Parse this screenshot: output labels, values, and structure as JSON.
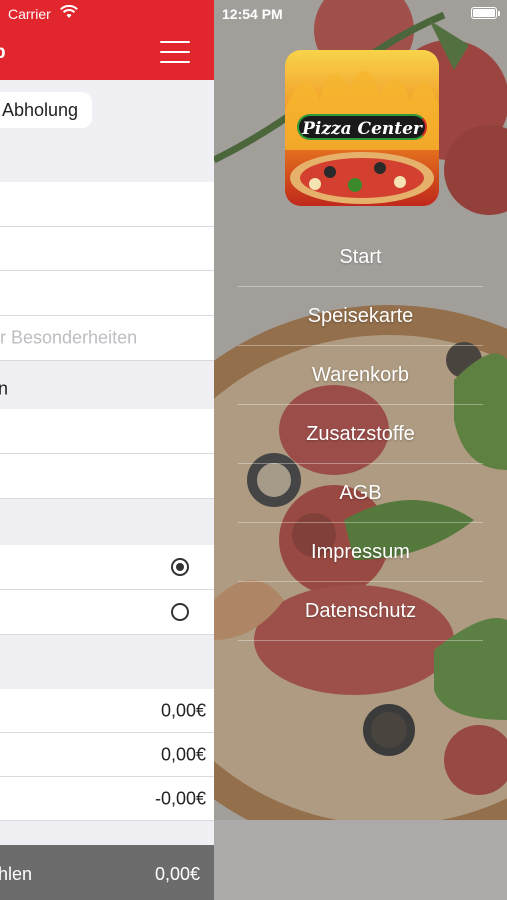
{
  "cart_panel": {
    "status": {
      "carrier": "Carrier"
    },
    "header": {
      "title": "b"
    },
    "delivery_option": "Abholung",
    "note_placeholder": "r Besonderheiten",
    "field_fragment": "n",
    "amounts": [
      "0,00€",
      "0,00€",
      "-0,00€"
    ],
    "bottom": {
      "label": "hlen",
      "total": "0,00€"
    }
  },
  "drawer": {
    "status": {
      "time": "12:54 PM"
    },
    "logo_text": "Pizza Center",
    "menu": [
      "Start",
      "Speisekarte",
      "Warenkorb",
      "Zusatzstoffe",
      "AGB",
      "Impressum",
      "Datenschutz"
    ]
  },
  "colors": {
    "brand_red": "#e2262d",
    "bottom_bar": "#6c6c6c"
  }
}
